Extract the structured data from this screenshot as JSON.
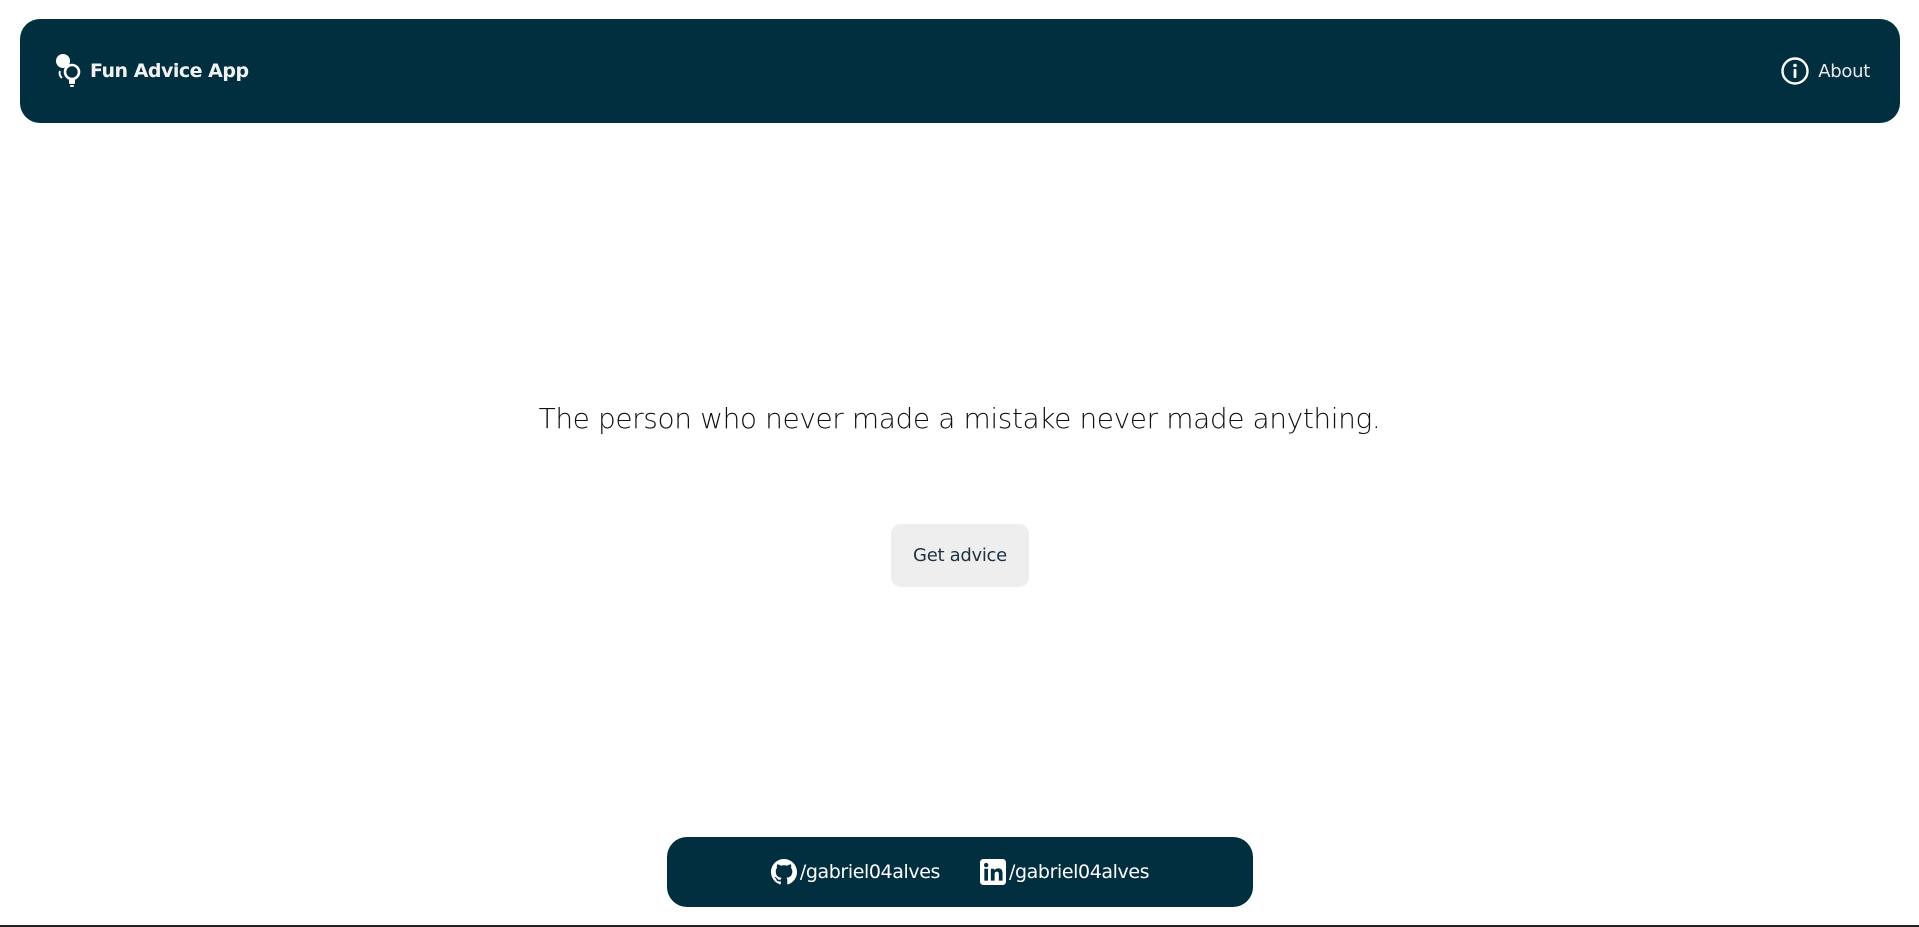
{
  "navbar": {
    "brand": {
      "icon": "lightbulb-icon",
      "label": "Fun Advice App"
    },
    "about": {
      "icon": "info-icon",
      "label": "About"
    }
  },
  "main": {
    "advice": "The person who never made a mistake never made anything.",
    "button_label": "Get advice"
  },
  "footer": {
    "links": [
      {
        "icon": "github-icon",
        "label": "/gabriel04alves"
      },
      {
        "icon": "linkedin-icon",
        "label": "/gabriel04alves"
      }
    ]
  },
  "colors": {
    "primary": "#022f40",
    "button_bg": "#eeeeee",
    "text": "#111111"
  }
}
